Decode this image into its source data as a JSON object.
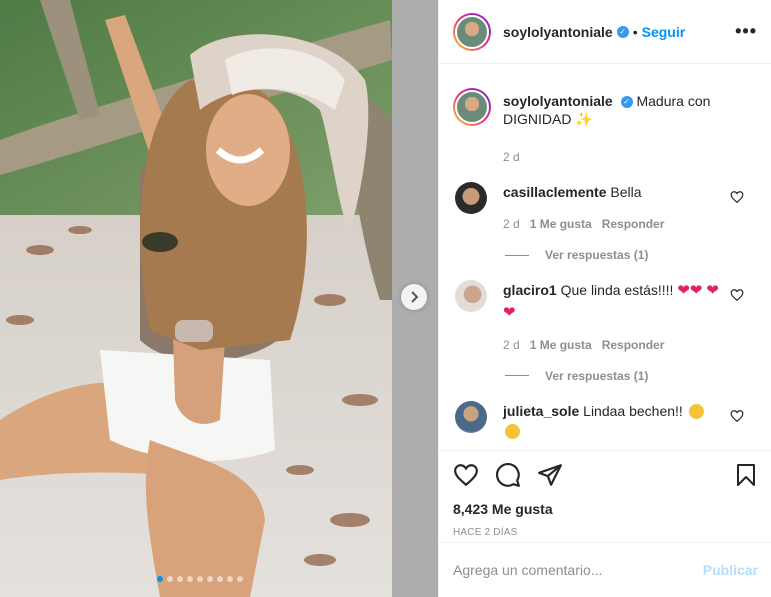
{
  "post": {
    "username": "soylolyantoniale",
    "follow_label": "Seguir",
    "bullet": "•",
    "more": "•••",
    "caption_text": "Madura con DIGNIDAD",
    "caption_time": "2 d",
    "likes": "8,423 Me gusta",
    "ago": "HACE 2 DÍAS"
  },
  "comments": [
    {
      "user": "casillaclemente",
      "text": "Bella",
      "time": "2 d",
      "likes": "1 Me gusta",
      "reply": "Responder",
      "view_replies": "Ver respuestas (1)"
    },
    {
      "user": "glaciro1",
      "text": "Que linda estás!!!!",
      "time": "2 d",
      "likes": "1 Me gusta",
      "reply": "Responder",
      "view_replies": "Ver respuestas (1)"
    },
    {
      "user": "julieta_sole",
      "text": "Lindaa bechen!!"
    }
  ],
  "composer": {
    "placeholder": "Agrega un comentario...",
    "publish": "Publicar"
  },
  "carousel": {
    "total": 9,
    "active": 0
  },
  "colors": {
    "link": "#0095f6",
    "verified": "#3897f0",
    "publish_disabled": "#b2dffc",
    "muted": "#8e8e8e"
  }
}
